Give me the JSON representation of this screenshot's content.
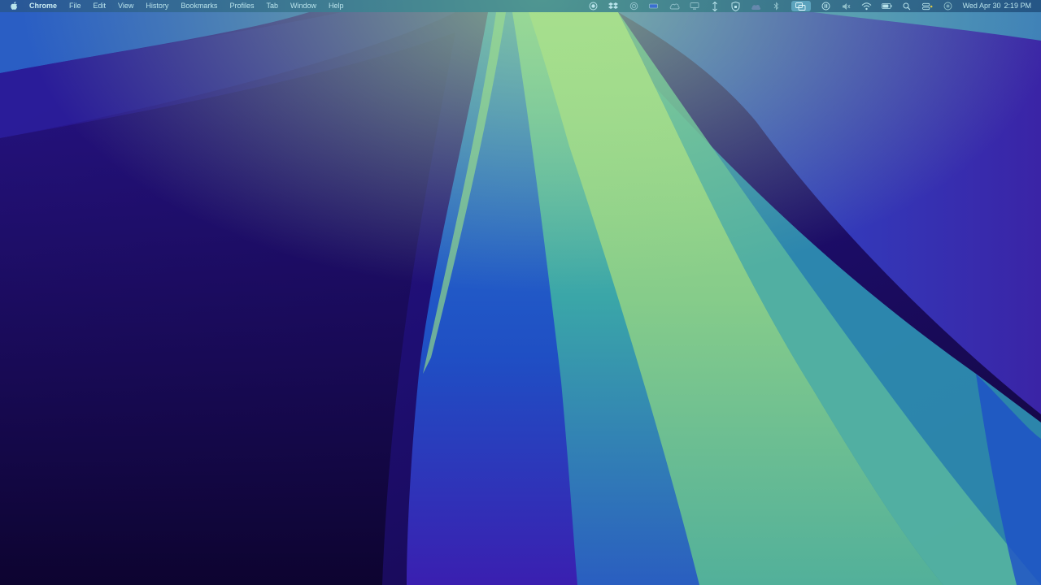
{
  "menubar": {
    "app_name": "Chrome",
    "menus": [
      "File",
      "Edit",
      "View",
      "History",
      "Bookmarks",
      "Profiles",
      "Tab",
      "Window",
      "Help"
    ],
    "status_icons": [
      "record-icon",
      "dropbox-icon",
      "sync-icon",
      "battery-meter-icon",
      "cloud-icon",
      "display-icon",
      "transfer-icon",
      "vpn-icon",
      "weather-icon",
      "bluetooth-icon",
      "screen-mirroring-icon",
      "focus-icon",
      "mute-icon",
      "wifi-icon",
      "battery-icon",
      "spotlight-search-icon",
      "control-center-icon",
      "siri-icon"
    ],
    "clock_date": "Wed Apr 30",
    "clock_time": "2:19 PM"
  },
  "colors": {
    "menubar_text": "#b9e4ec",
    "wallpaper_dark": "#12063a",
    "wallpaper_blue": "#2a24a8",
    "wallpaper_green": "#94d37f"
  }
}
